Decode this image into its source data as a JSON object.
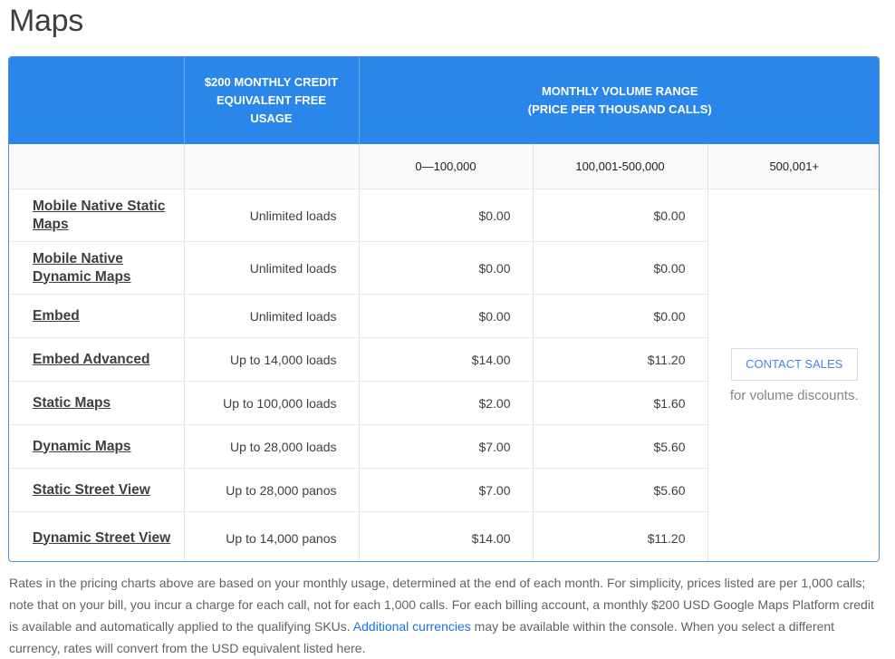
{
  "page": {
    "title": "Maps"
  },
  "table": {
    "header": {
      "empty": "",
      "credit": "$200 MONTHLY CREDIT EQUIVALENT FREE USAGE",
      "volume_line1": "MONTHLY VOLUME RANGE",
      "volume_line2": "(PRICE PER THOUSAND CALLS)"
    },
    "ranges": [
      "0—100,000",
      "100,001-500,000",
      "500,001+"
    ],
    "rows": [
      {
        "product": "Mobile Native Static Maps",
        "usage": "Unlimited loads",
        "tier1": "$0.00",
        "tier2": "$0.00"
      },
      {
        "product": "Mobile Native Dynamic Maps",
        "usage": "Unlimited loads",
        "tier1": "$0.00",
        "tier2": "$0.00"
      },
      {
        "product": "Embed",
        "usage": "Unlimited loads",
        "tier1": "$0.00",
        "tier2": "$0.00"
      },
      {
        "product": "Embed Advanced",
        "usage": "Up to 14,000 loads",
        "tier1": "$14.00",
        "tier2": "$11.20"
      },
      {
        "product": "Static Maps",
        "usage": "Up to 100,000 loads",
        "tier1": "$2.00",
        "tier2": "$1.60"
      },
      {
        "product": "Dynamic Maps",
        "usage": "Up to 28,000 loads",
        "tier1": "$7.00",
        "tier2": "$5.60"
      },
      {
        "product": "Static Street View",
        "usage": "Up to 28,000 panos",
        "tier1": "$7.00",
        "tier2": "$5.60"
      },
      {
        "product": "Dynamic Street View",
        "usage": "Up to 14,000 panos",
        "tier1": "$14.00",
        "tier2": "$11.20"
      }
    ],
    "contact": {
      "button_label": "CONTACT SALES",
      "note": "for volume discounts."
    }
  },
  "footnote": {
    "part1": "Rates in the pricing charts above are based on your monthly usage, determined at the end of each month. For simplicity, prices listed are per 1,000 calls; note that on your bill, you incur a charge for each call, not for each 1,000 calls. For each billing account, a monthly $200 USD Google Maps Platform credit is available and automatically applied to the qualifying SKUs. ",
    "link": "Additional currencies",
    "part2": " may be available within the console. When you select a different currency, rates will convert from the USD equivalent listed here."
  },
  "colors": {
    "header_bg": "#2b86ea",
    "link": "#1a73e8",
    "button_text": "#4285f4"
  }
}
